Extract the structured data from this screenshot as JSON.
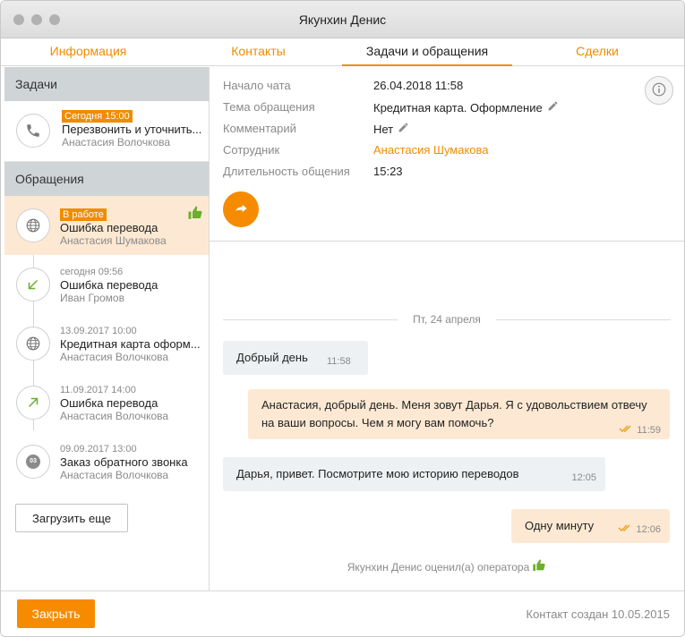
{
  "window": {
    "title": "Якунхин Денис"
  },
  "tabs": [
    {
      "label": "Информация"
    },
    {
      "label": "Контакты"
    },
    {
      "label": "Задачи и обращения"
    },
    {
      "label": "Сделки"
    }
  ],
  "sidebar": {
    "tasks_header": "Задачи",
    "task": {
      "badge": "Сегодня 15:00",
      "title": "Перезвонить и уточнить...",
      "person": "Анастасия Волочкова",
      "icon": "phone-icon"
    },
    "requests_header": "Обращения",
    "requests": [
      {
        "date": "В работе",
        "title": "Ошибка перевода",
        "person": "Анастасия Шумакова",
        "icon": "globe-icon"
      },
      {
        "date": "сегодня 09:56",
        "title": "Ошибка перевода",
        "person": "Иван Громов",
        "icon": "arrow-incoming-icon"
      },
      {
        "date": "13.09.2017 10:00",
        "title": "Кредитная карта оформ...",
        "person": "Анастасия Волочкова",
        "icon": "globe-icon"
      },
      {
        "date": "11.09.2017 14:00",
        "title": "Ошибка перевода",
        "person": "Анастасия Волочкова",
        "icon": "arrow-outgoing-icon"
      },
      {
        "date": "09.09.2017 13:00",
        "title": "Заказ обратного звонка",
        "person": "Анастасия Волочкова",
        "icon": "callback-icon",
        "icon_text": "03"
      }
    ],
    "load_more": "Загрузить еще"
  },
  "details": {
    "chat_start_label": "Начало чата",
    "chat_start": "26.04.2018 11:58",
    "topic_label": "Тема обращения",
    "topic": "Кредитная карта. Оформление",
    "comment_label": "Комментарий",
    "comment": "Нет",
    "employee_label": "Сотрудник",
    "employee": "Анастасия Шумакова",
    "duration_label": "Длительность общения",
    "duration": "15:23"
  },
  "chat": {
    "date_separator": "Пт, 24 апреля",
    "messages": [
      {
        "text": "Добрый день",
        "time": "11:58",
        "dir": "in"
      },
      {
        "text": "Анастасия, добрый день. Меня зовут Дарья. Я с удовольствием отвечу на ваши вопросы. Чем я могу вам помочь?",
        "time": "11:59",
        "dir": "out"
      },
      {
        "text": "Дарья, привет. Посмотрите мою историю переводов",
        "time": "12:05",
        "dir": "in"
      },
      {
        "text": "Одну минуту",
        "time": "12:06",
        "dir": "out"
      }
    ],
    "rating": "Якунхин Денис оценил(а) оператора"
  },
  "footer": {
    "close": "Закрыть",
    "created": "Контакт создан 10.05.2015"
  },
  "colors": {
    "accent": "#f68b00",
    "active_bg": "#fde9d3",
    "section_bg": "#cfd4d7",
    "like": "#6cae2d"
  }
}
